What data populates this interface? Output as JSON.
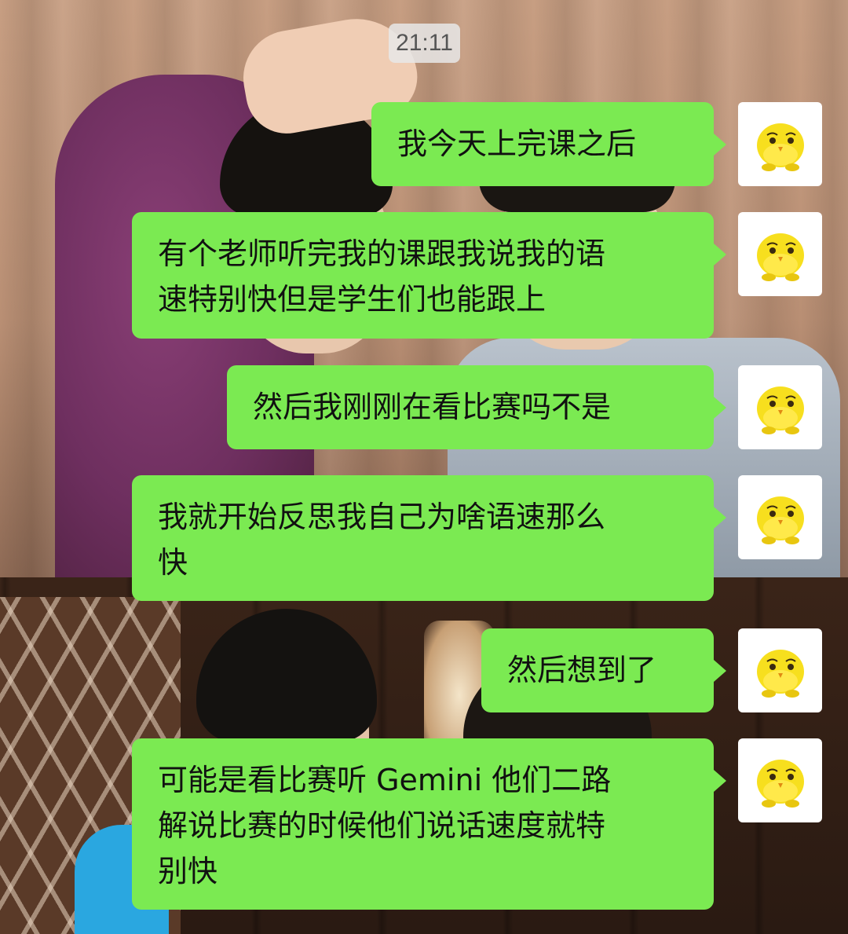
{
  "timestamp": "21:11",
  "colors": {
    "bubble_green": "#7bea52",
    "timestamp_bg": "#e8e8e8",
    "avatar_yellow": "#f7df1e"
  },
  "avatar": {
    "icon": "yellow-chick-avatar-icon"
  },
  "messages": [
    {
      "text": "我今天上完课之后"
    },
    {
      "text": "有个老师听完我的课跟我说我的语\n速特别快但是学生们也能跟上"
    },
    {
      "text": "然后我刚刚在看比赛吗不是"
    },
    {
      "text": "我就开始反思我自己为啥语速那么\n快"
    },
    {
      "text": "然后想到了"
    },
    {
      "text": "可能是看比赛听 Gemini 他们二路\n解说比赛的时候他们说话速度就特\n别快"
    }
  ]
}
